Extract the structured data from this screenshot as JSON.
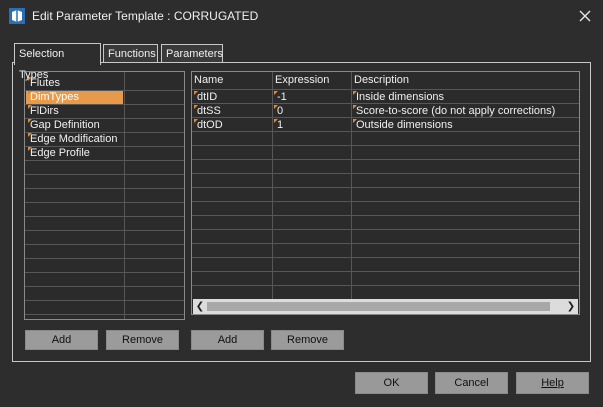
{
  "window": {
    "title": "Edit Parameter Template : CORRUGATED",
    "close_icon": "close-icon",
    "app_icon": "application-icon"
  },
  "tabs": [
    {
      "label": "Selection Types",
      "active": true
    },
    {
      "label": "Functions",
      "active": false
    },
    {
      "label": "Parameters",
      "active": false
    }
  ],
  "selection_list": {
    "items": [
      {
        "label": "Flutes",
        "selected": false
      },
      {
        "label": "DimTypes",
        "selected": true
      },
      {
        "label": "FlDirs",
        "selected": false
      },
      {
        "label": "Gap Definition",
        "selected": false
      },
      {
        "label": "Edge Modification",
        "selected": false
      },
      {
        "label": "Edge Profile",
        "selected": false
      }
    ]
  },
  "values_table": {
    "columns": [
      "Name",
      "Expression",
      "Description"
    ],
    "rows": [
      {
        "name": "dtID",
        "expression": "-1",
        "description": "Inside dimensions"
      },
      {
        "name": "dtSS",
        "expression": "0",
        "description": "Score-to-score (do not apply corrections)"
      },
      {
        "name": "dtOD",
        "expression": "1",
        "description": "Outside dimensions"
      }
    ]
  },
  "left_buttons": {
    "add": "Add",
    "remove": "Remove"
  },
  "right_buttons": {
    "add": "Add",
    "remove": "Remove"
  },
  "footer": {
    "ok": "OK",
    "cancel": "Cancel",
    "help": "Help"
  },
  "colors": {
    "accent": "#e89a4b",
    "marker": "#e08a2e",
    "background": "#2d2d2d"
  }
}
